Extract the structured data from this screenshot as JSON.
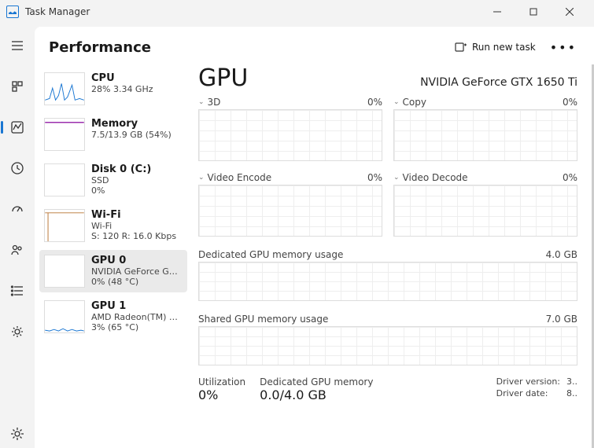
{
  "window": {
    "title": "Task Manager"
  },
  "header": {
    "title": "Performance",
    "run_new_task": "Run new task"
  },
  "list": {
    "cpu": {
      "name": "CPU",
      "sub1": "28%  3.34 GHz"
    },
    "mem": {
      "name": "Memory",
      "sub1": "7.5/13.9 GB (54%)"
    },
    "disk": {
      "name": "Disk 0 (C:)",
      "sub1": "SSD",
      "sub2": "0%"
    },
    "wifi": {
      "name": "Wi-Fi",
      "sub1": "Wi-Fi",
      "sub2": "S: 120 R: 16.0 Kbps"
    },
    "gpu0": {
      "name": "GPU 0",
      "sub1": "NVIDIA GeForce G…",
      "sub2": "0%  (48 °C)"
    },
    "gpu1": {
      "name": "GPU 1",
      "sub1": "AMD Radeon(TM) …",
      "sub2": "3%  (65 °C)"
    }
  },
  "detail": {
    "title": "GPU",
    "model": "NVIDIA GeForce GTX 1650 Ti",
    "panes": {
      "3d": {
        "label": "3D",
        "value": "0%"
      },
      "copy": {
        "label": "Copy",
        "value": "0%"
      },
      "venc": {
        "label": "Video Encode",
        "value": "0%"
      },
      "vdec": {
        "label": "Video Decode",
        "value": "0%"
      }
    },
    "dedicated": {
      "label": "Dedicated GPU memory usage",
      "max": "4.0 GB"
    },
    "shared": {
      "label": "Shared GPU memory usage",
      "max": "7.0 GB"
    },
    "stats": {
      "util": {
        "label": "Utilization",
        "value": "0%"
      },
      "dedmem": {
        "label": "Dedicated GPU memory",
        "value": "0.0/4.0 GB"
      },
      "drvver": {
        "label": "Driver version:",
        "value": "3.."
      },
      "drvdate": {
        "label": "Driver date:",
        "value": "8.."
      }
    }
  }
}
